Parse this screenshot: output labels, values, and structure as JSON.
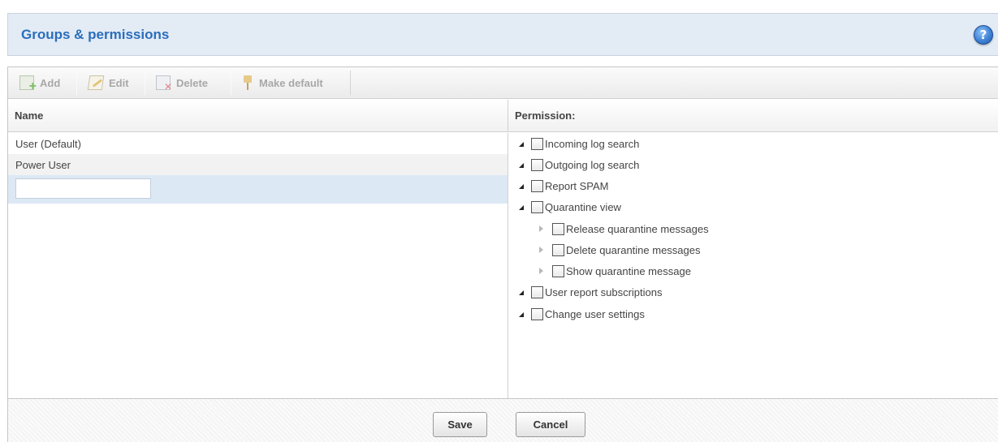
{
  "header": {
    "title": "Groups & permissions",
    "help_glyph": "?"
  },
  "toolbar": {
    "add_label": "Add",
    "edit_label": "Edit",
    "delete_label": "Delete",
    "make_default_label": "Make default"
  },
  "columns": {
    "name": "Name",
    "permission": "Permission:"
  },
  "groups": [
    {
      "label": "User (Default)"
    },
    {
      "label": "Power User"
    }
  ],
  "new_group_input": {
    "value": "",
    "placeholder": ""
  },
  "permissions": [
    {
      "label": "Incoming log search"
    },
    {
      "label": "Outgoing log search"
    },
    {
      "label": "Report SPAM"
    },
    {
      "label": "Quarantine view"
    },
    {
      "label": "Release quarantine messages"
    },
    {
      "label": "Delete quarantine messages"
    },
    {
      "label": "Show quarantine message"
    },
    {
      "label": "User report subscriptions"
    },
    {
      "label": "Change user settings"
    }
  ],
  "footer": {
    "save_label": "Save",
    "cancel_label": "Cancel"
  }
}
